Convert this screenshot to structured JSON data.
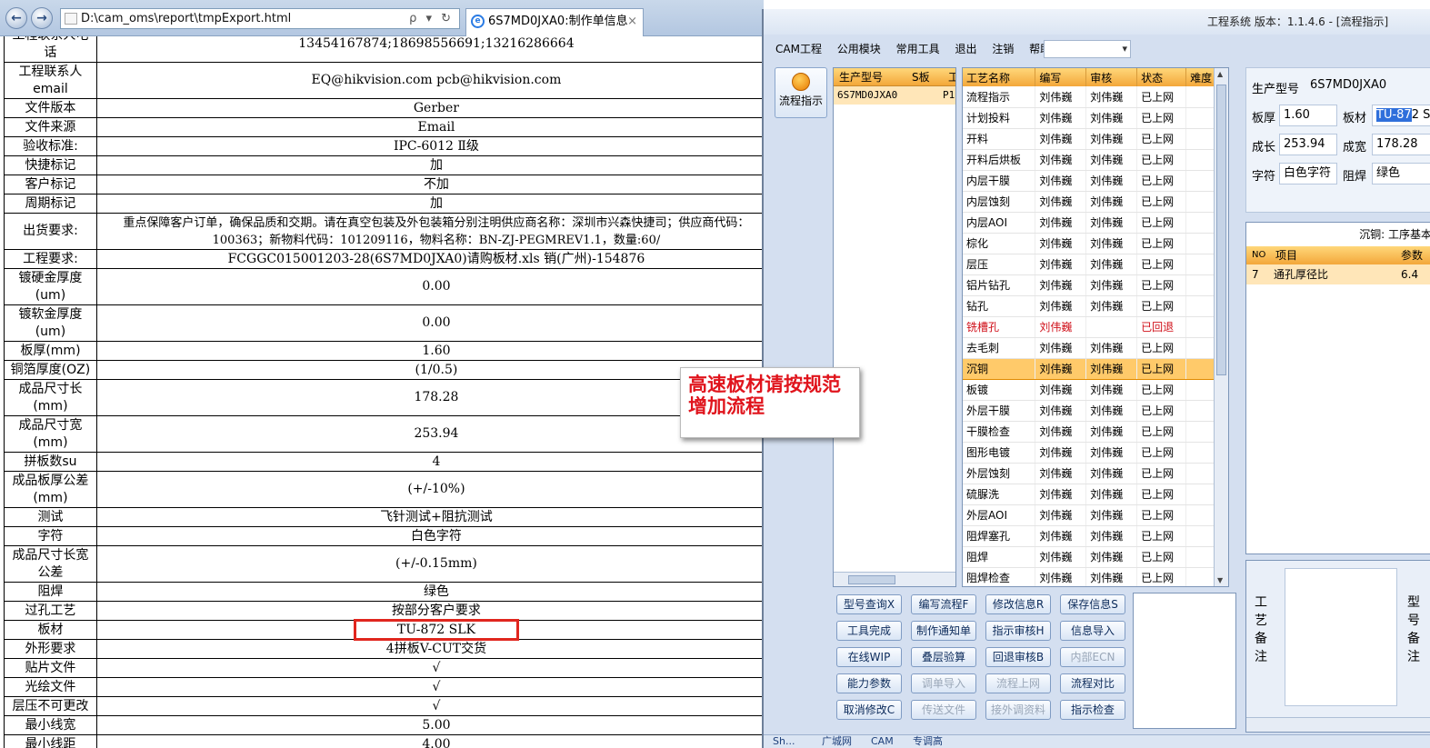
{
  "browser": {
    "address": "D:\\cam_oms\\report\\tmpExport.html",
    "address_tools": "ρ ▾ ↻",
    "tab_title": "6S7MD0JXA0:制作单信息",
    "tab_close": "×",
    "ie_glyph": "e"
  },
  "doc_rows": [
    {
      "key": "工程联系人电话",
      "value": "13454167874;18698556691;13216286664"
    },
    {
      "key": "工程联系人email",
      "value": "EQ@hikvision.com pcb@hikvision.com"
    },
    {
      "key": "文件版本",
      "value": "Gerber"
    },
    {
      "key": "文件来源",
      "value": "Email"
    },
    {
      "key": "验收标准:",
      "value": "IPC-6012 Ⅱ级"
    },
    {
      "key": "快捷标记",
      "value": "加"
    },
    {
      "key": "客户标记",
      "value": "不加"
    },
    {
      "key": "周期标记",
      "value": "加"
    },
    {
      "key": "出货要求:",
      "value": "重点保障客户订单，确保品质和交期。请在真空包装及外包装箱分别注明供应商名称：深圳市兴森快捷司；供应商代码：100363；新物料代码：101209116，物料名称：BN-ZJ-PEGMREV1.1，数量:60/"
    },
    {
      "key": "工程要求:",
      "value": "FCGGC015001203-28(6S7MD0JXA0)请购板材.xls 销(广州)-154876"
    },
    {
      "key": "镀硬金厚度(um)",
      "value": "0.00"
    },
    {
      "key": "镀软金厚度(um)",
      "value": "0.00"
    },
    {
      "key": "板厚(mm)",
      "value": "1.60"
    },
    {
      "key": "铜箔厚度(OZ)",
      "value": "(1/0.5)"
    },
    {
      "key": "成品尺寸长(mm)",
      "value": "178.28"
    },
    {
      "key": "成品尺寸宽(mm)",
      "value": "253.94"
    },
    {
      "key": "拼板数su",
      "value": "4"
    },
    {
      "key": "成品板厚公差(mm)",
      "value": "(+/-10%)"
    },
    {
      "key": "测试",
      "value": "飞针测试+阻抗测试"
    },
    {
      "key": "字符",
      "value": "白色字符"
    },
    {
      "key": "成品尺寸长宽公差",
      "value": "(+/-0.15mm)"
    },
    {
      "key": "阻焊",
      "value": "绿色"
    },
    {
      "key": "过孔工艺",
      "value": "按部分客户要求"
    },
    {
      "key": "板材",
      "value": "TU-872 SLK"
    },
    {
      "key": "外形要求",
      "value": "4拼板V-CUT交货"
    },
    {
      "key": "贴片文件",
      "value": "√"
    },
    {
      "key": "光绘文件",
      "value": "√"
    },
    {
      "key": "层压不可更改",
      "value": "√"
    },
    {
      "key": "最小线宽",
      "value": "5.00"
    },
    {
      "key": "最小线距",
      "value": "4.00"
    }
  ],
  "cam": {
    "title": "工程系统   版本：1.1.4.6 - [流程指示]",
    "menu": [
      "CAM工程",
      "公用模块",
      "常用工具",
      "退出",
      "注销",
      "帮助"
    ],
    "flow_button": "流程指示",
    "model_list": {
      "headers": [
        "生产型号",
        "S板",
        "工"
      ],
      "rows": [
        {
          "model": "6S7MD0JXA0",
          "extra": "P1"
        }
      ]
    },
    "proc_headers": [
      "工艺名称",
      "编写",
      "审核",
      "状态",
      "难度"
    ],
    "proc_rows": [
      [
        "流程指示",
        "刘伟巍",
        "刘伟巍",
        "已上网",
        ""
      ],
      [
        "计划投料",
        "刘伟巍",
        "刘伟巍",
        "已上网",
        ""
      ],
      [
        "开料",
        "刘伟巍",
        "刘伟巍",
        "已上网",
        ""
      ],
      [
        "开料后烘板",
        "刘伟巍",
        "刘伟巍",
        "已上网",
        ""
      ],
      [
        "内层干膜",
        "刘伟巍",
        "刘伟巍",
        "已上网",
        ""
      ],
      [
        "内层蚀刻",
        "刘伟巍",
        "刘伟巍",
        "已上网",
        ""
      ],
      [
        "内层AOI",
        "刘伟巍",
        "刘伟巍",
        "已上网",
        ""
      ],
      [
        "棕化",
        "刘伟巍",
        "刘伟巍",
        "已上网",
        ""
      ],
      [
        "层压",
        "刘伟巍",
        "刘伟巍",
        "已上网",
        ""
      ],
      [
        "铝片钻孔",
        "刘伟巍",
        "刘伟巍",
        "已上网",
        ""
      ],
      [
        "钻孔",
        "刘伟巍",
        "刘伟巍",
        "已上网",
        ""
      ],
      [
        "铣槽孔",
        "刘伟巍",
        "",
        "已回退",
        ""
      ],
      [
        "去毛刺",
        "刘伟巍",
        "刘伟巍",
        "已上网",
        ""
      ],
      [
        "沉铜",
        "刘伟巍",
        "刘伟巍",
        "已上网",
        ""
      ],
      [
        "板镀",
        "刘伟巍",
        "刘伟巍",
        "已上网",
        ""
      ],
      [
        "外层干膜",
        "刘伟巍",
        "刘伟巍",
        "已上网",
        ""
      ],
      [
        "干膜检查",
        "刘伟巍",
        "刘伟巍",
        "已上网",
        ""
      ],
      [
        "图形电镀",
        "刘伟巍",
        "刘伟巍",
        "已上网",
        ""
      ],
      [
        "外层蚀刻",
        "刘伟巍",
        "刘伟巍",
        "已上网",
        ""
      ],
      [
        "硫脲洗",
        "刘伟巍",
        "刘伟巍",
        "已上网",
        ""
      ],
      [
        "外层AOI",
        "刘伟巍",
        "刘伟巍",
        "已上网",
        ""
      ],
      [
        "阻焊塞孔",
        "刘伟巍",
        "刘伟巍",
        "已上网",
        ""
      ],
      [
        "阻焊",
        "刘伟巍",
        "刘伟巍",
        "已上网",
        ""
      ],
      [
        "阻焊检查",
        "刘伟巍",
        "刘伟巍",
        "已上网",
        ""
      ]
    ],
    "callout": "高速板材请按规范增加流程",
    "buttons": [
      [
        "型号查询X",
        "编写流程F",
        "修改信息R",
        "保存信息S"
      ],
      [
        "工具完成",
        "制作通知单",
        "指示审核H",
        "信息导入"
      ],
      [
        "在线WIP",
        "叠层验算",
        "回退审核B",
        "内部ECN"
      ],
      [
        "能力参数",
        "调单导入",
        "流程上网",
        "流程对比"
      ],
      [
        "取消修改C",
        "传送文件",
        "接外调资料",
        "指示检查"
      ]
    ],
    "info": {
      "model_label": "生产型号",
      "model_value": "6S7MD0JXA0",
      "thick_label": "板厚",
      "thick_value": "1.60",
      "material_label": "板材",
      "material_value_sel": "TU-87",
      "material_value_rest": "2 S",
      "len_label": "成长",
      "len_value": "253.94",
      "wid_label": "成宽",
      "wid_value": "178.28",
      "char_label": "字符",
      "char_value": "白色字符",
      "mask_label": "阻焊",
      "mask_value": "绿色"
    },
    "work": {
      "caption": "沉铜:  工序基本",
      "headers": [
        "NO",
        "项目",
        "参数"
      ],
      "row": [
        "7",
        "通孔厚径比",
        "6.4"
      ]
    },
    "remark": {
      "left_label": "工艺备注",
      "right_label": "型号备注"
    },
    "status_tabs": [
      "Sh...",
      "广城网",
      "CAM",
      "专调高"
    ],
    "colors": {
      "accent": "#f3a73a",
      "selected_row": "#ffca6a",
      "rollback": "#d0101a",
      "highlight_box": "#e0261e"
    }
  }
}
